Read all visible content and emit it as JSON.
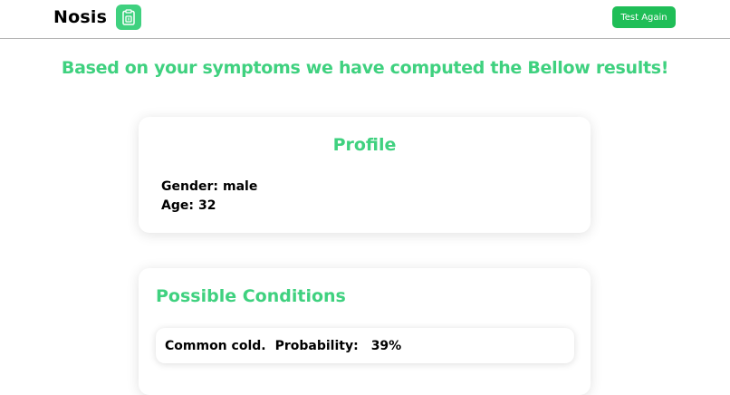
{
  "header": {
    "brand": "Nosis",
    "logo_icon": "clipboard-icon",
    "test_again_label": "Test Again"
  },
  "headline": "Based on your symptoms we have computed the Bellow results!",
  "profile": {
    "title": "Profile",
    "gender_label": "Gender:",
    "gender_value": "male",
    "age_label": "Age:",
    "age_value": "32"
  },
  "conditions": {
    "title": "Possible Conditions",
    "items": [
      {
        "name": "Common cold.",
        "probability_label": "Probability:",
        "probability": "39%"
      }
    ]
  },
  "colors": {
    "accent": "#3fd17f",
    "button": "#1fbe57"
  }
}
